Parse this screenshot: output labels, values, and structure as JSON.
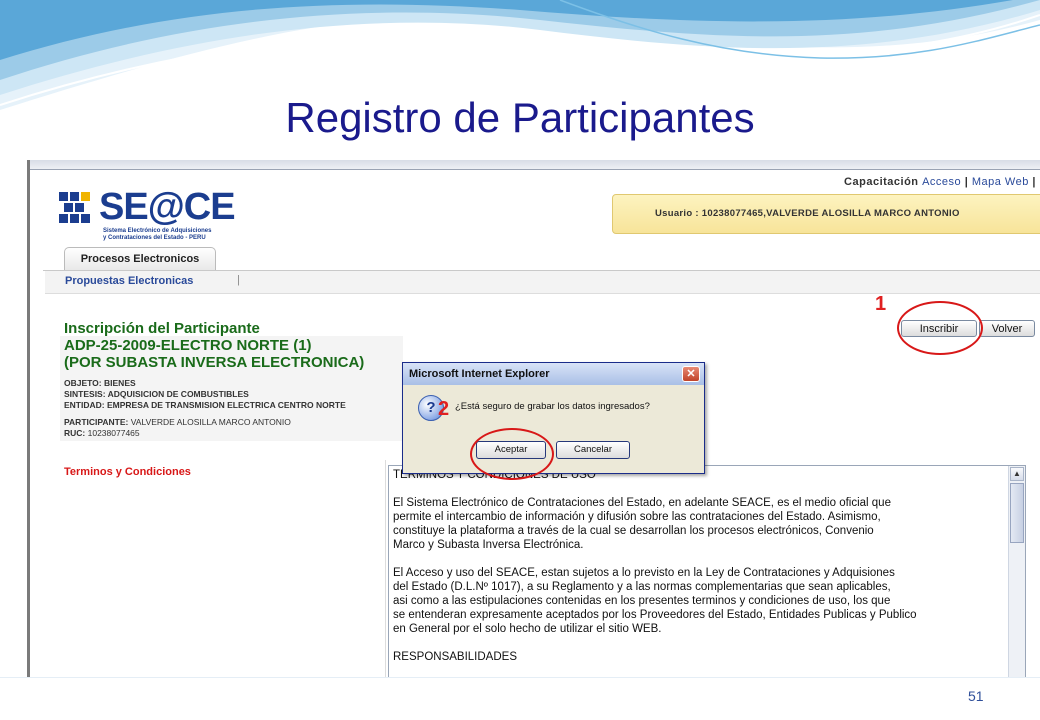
{
  "slide": {
    "title": "Registro de Participantes",
    "page_number": "51"
  },
  "header": {
    "site": "Capacitación",
    "links": [
      "Acceso",
      "Mapa Web"
    ],
    "separator": "|",
    "user_label": "Usuario : 10238077465,VALVERDE ALOSILLA MARCO ANTONIO"
  },
  "logo": {
    "text": "SE@CE",
    "subtitle_line1": "Sistema Electrónico de Adquisiciones",
    "subtitle_line2": "y Contrataciones del Estado - PERU"
  },
  "tabs": [
    {
      "label": "Procesos Electronicos"
    }
  ],
  "subnav": {
    "item": "Propuestas Electronicas",
    "separator": "|"
  },
  "form": {
    "title": "Inscripción del Participante",
    "process_line1": "ADP-25-2009-ELECTRO NORTE (1)",
    "process_line2": "(POR SUBASTA INVERSA ELECTRONICA)",
    "objeto_label": "OBJETO:",
    "objeto_value": "BIENES",
    "sintesis_label": "SINTESIS:",
    "sintesis_value": "ADQUISICION DE COMBUSTIBLES",
    "entidad_label": "ENTIDAD:",
    "entidad_value": "EMPRESA DE TRANSMISION ELECTRICA CENTRO NORTE",
    "participante_label": "PARTICIPANTE:",
    "participante_value": "VALVERDE ALOSILLA MARCO ANTONIO",
    "ruc_label": "RUC:",
    "ruc_value": "10238077465",
    "inscribir_button": "Inscribir",
    "volver_button": "Volver",
    "terms_label": "Terminos y Condiciones",
    "terms_text": "TERMINOS Y CONDICIONES DE USO\n\nEl Sistema Electrónico de Contrataciones del Estado, en adelante SEACE, es el medio oficial que\npermite el intercambio de información y difusión sobre las contrataciones del Estado. Asimismo,\nconstituye la plataforma a través de la cual se desarrollan los procesos electrónicos, Convenio\nMarco y Subasta Inversa Electrónica.\n\nEl Acceso y uso del SEACE, estan sujetos a lo previsto en la Ley de Contrataciones y Adquisiones\ndel Estado (D.L.Nº 1017), a su Reglamento y a las normas complementarias que sean aplicables,\nasi como a las estipulaciones contenidas en los presentes terminos y condiciones de uso, los que\nse entenderan expresamente aceptados por los Proveedores del Estado, Entidades Publicas y Publico\nen General por el solo hecho de utilizar el sitio WEB.\n\nRESPONSABILIDADES"
  },
  "dialog": {
    "title": "Microsoft Internet Explorer",
    "message": "¿Está seguro de grabar los datos ingresados?",
    "icon_glyph": "?",
    "ok_button": "Aceptar",
    "cancel_button": "Cancelar",
    "close_glyph": "✕"
  },
  "annotations": {
    "step1": "1",
    "step2": "2",
    "color": "#d81818"
  },
  "colors": {
    "title": "#1a1a8c",
    "green_heading": "#1a6b1a",
    "link_blue": "#2a4a9a"
  }
}
